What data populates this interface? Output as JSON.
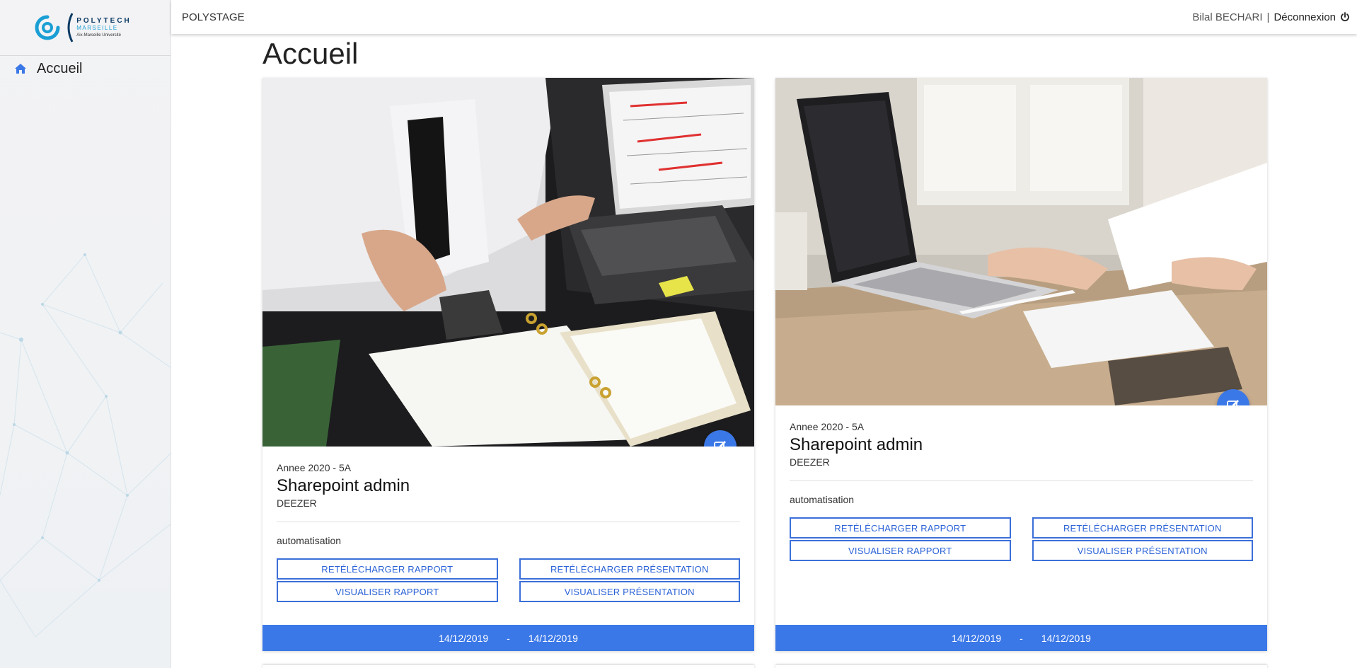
{
  "app": {
    "brand": "POLYSTAGE",
    "logo": {
      "line1": "POLYTECH",
      "line2": "MARSEILLE",
      "line3": "Aix-Marseille Université"
    }
  },
  "user": {
    "name": "Bilal BECHARI",
    "separator": "|",
    "logout_label": "Déconnexion"
  },
  "sidebar": {
    "items": [
      {
        "label": "Accueil",
        "icon": "home-icon"
      }
    ]
  },
  "page": {
    "title": "Accueil"
  },
  "colors": {
    "accent": "#3b78e7",
    "button_border": "#3b6fd9"
  },
  "cards": [
    {
      "year": "Annee 2020 - 5A",
      "title": "Sharepoint admin",
      "company": "DEEZER",
      "keyword": "automatisation",
      "buttons": {
        "download_report": "RETÉLÉCHARGER RAPPORT",
        "download_presentation": "RETÉLÉCHARGER PRÉSENTATION",
        "view_report": "VISUALISER RAPPORT",
        "view_presentation": "VISUALISER PRÉSENTATION"
      },
      "start_date": "14/12/2019",
      "date_separator": "-",
      "end_date": "14/12/2019"
    },
    {
      "year": "Annee 2020 - 5A",
      "title": "Sharepoint admin",
      "company": "DEEZER",
      "keyword": "automatisation",
      "buttons": {
        "download_report": "RETÉLÉCHARGER RAPPORT",
        "download_presentation": "RETÉLÉCHARGER PRÉSENTATION",
        "view_report": "VISUALISER RAPPORT",
        "view_presentation": "VISUALISER PRÉSENTATION"
      },
      "start_date": "14/12/2019",
      "date_separator": "-",
      "end_date": "14/12/2019"
    }
  ]
}
